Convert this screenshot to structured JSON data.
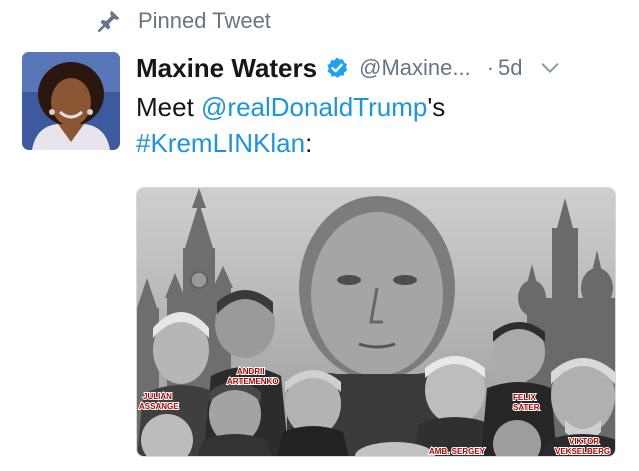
{
  "pinned": {
    "label": "Pinned Tweet",
    "icon": "pin-icon"
  },
  "tweet": {
    "display_name": "Maxine Waters",
    "handle": "@Maxine...",
    "dot": "·",
    "time": "5d",
    "text_before": "Meet ",
    "mention": "@realDonaldTrump",
    "text_mid": "'s",
    "hashtag": "#KremLINKlan",
    "text_end": ":"
  },
  "media": {
    "captions": {
      "julian": [
        "JULIAN",
        "ASSANGE"
      ],
      "andrii": [
        "ANDRII",
        "ARTEMENKO"
      ],
      "felix": [
        "FELIX",
        "SATER"
      ],
      "viktor": [
        "VIKTOR",
        "VEKSELBERG"
      ],
      "sergey": "AMB. SERGEY"
    }
  },
  "colors": {
    "link": "#1b95e0",
    "secondary_text": "#657786",
    "verified": "#1da1f2"
  }
}
